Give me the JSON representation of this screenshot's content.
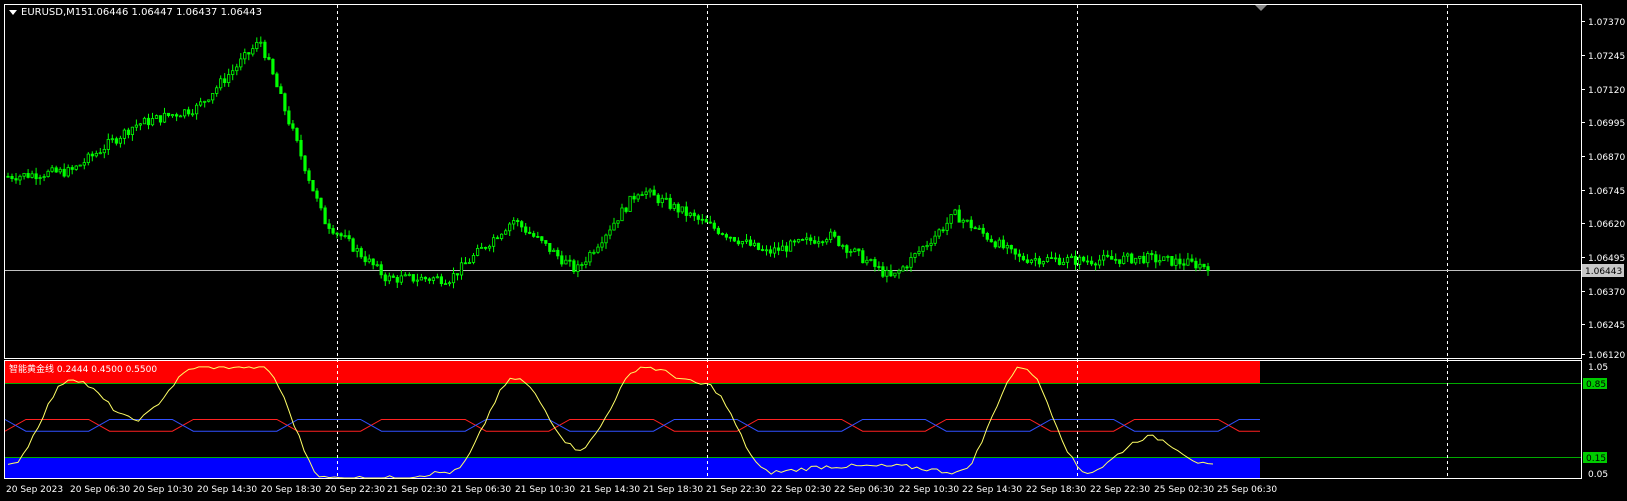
{
  "header": {
    "symbol_label": "EURUSD,M15",
    "ohlc": "1.06446 1.06447 1.06437 1.06443"
  },
  "price_axis": {
    "ticks": [
      "1.07370",
      "1.07245",
      "1.07120",
      "1.06995",
      "1.06870",
      "1.06745",
      "1.06620",
      "1.06495",
      "1.06370",
      "1.06245",
      "1.06120"
    ],
    "current_price": "1.06443"
  },
  "indicator": {
    "label": "智能黄金线 0.2444 0.4500 0.5500",
    "axis_ticks": {
      "top": "1.05",
      "upper_level": "0.85",
      "lower_level": "0.15",
      "bottom": "0.05"
    }
  },
  "time_axis": {
    "labels": [
      "20 Sep 2023",
      "20 Sep 06:30",
      "20 Sep 10:30",
      "20 Sep 14:30",
      "20 Sep 18:30",
      "20 Sep 22:30",
      "21 Sep 02:30",
      "21 Sep 06:30",
      "21 Sep 10:30",
      "21 Sep 14:30",
      "21 Sep 18:30",
      "21 Sep 22:30",
      "22 Sep 02:30",
      "22 Sep 06:30",
      "22 Sep 10:30",
      "22 Sep 14:30",
      "22 Sep 18:30",
      "22 Sep 22:30",
      "25 Sep 02:30",
      "25 Sep 06:30"
    ]
  },
  "colors": {
    "background": "#000000",
    "candles": "#00ff00",
    "grid": "#ffffff",
    "axis_text": "#ffffff",
    "current_price_line": "#c0c0c0",
    "zone_upper": "#ff0000",
    "zone_lower": "#0000ff",
    "oscillator_line": "#ffff66",
    "red_line": "#ff2020",
    "blue_line": "#3050ff",
    "level_box": "#00cc00"
  },
  "chart_data": {
    "type": "candlestick",
    "symbol": "EURUSD",
    "timeframe": "M15",
    "ylim": [
      1.0612,
      1.0742
    ],
    "close_path": [
      {
        "time": "20 Sep 2023",
        "value": 1.068
      },
      {
        "time": "20 Sep 06:30",
        "value": 1.0682
      },
      {
        "time": "20 Sep 10:30",
        "value": 1.07
      },
      {
        "time": "20 Sep 14:30",
        "value": 1.0707
      },
      {
        "time": "20 Sep 18:30",
        "value": 1.0733
      },
      {
        "time": "20 Sep 22:30",
        "value": 1.0663
      },
      {
        "time": "21 Sep 02:30",
        "value": 1.064
      },
      {
        "time": "21 Sep 06:30",
        "value": 1.064
      },
      {
        "time": "21 Sep 10:30",
        "value": 1.0663
      },
      {
        "time": "21 Sep 14:30",
        "value": 1.0643
      },
      {
        "time": "21 Sep 18:30",
        "value": 1.0675
      },
      {
        "time": "21 Sep 22:30",
        "value": 1.0662
      },
      {
        "time": "22 Sep 02:30",
        "value": 1.065
      },
      {
        "time": "22 Sep 06:30",
        "value": 1.0657
      },
      {
        "time": "22 Sep 10:30",
        "value": 1.064
      },
      {
        "time": "22 Sep 14:30",
        "value": 1.0665
      },
      {
        "time": "22 Sep 18:30",
        "value": 1.0648
      },
      {
        "time": "22 Sep 22:30",
        "value": 1.0647
      },
      {
        "time": "25 Sep 02:30",
        "value": 1.0648
      },
      {
        "time": "25 Sep 06:30",
        "value": 1.0645
      }
    ],
    "indicator": {
      "name": "智能黄金线",
      "values": [
        0.2444,
        0.45,
        0.55
      ],
      "ylim": [
        0.05,
        1.05
      ],
      "levels": [
        0.85,
        0.15
      ],
      "oscillator_path": [
        0.15,
        0.9,
        0.55,
        1.0,
        1.0,
        0.05,
        0.05,
        0.1,
        0.9,
        0.3,
        1.0,
        0.85,
        0.1,
        0.15,
        0.15,
        0.1,
        1.0,
        0.1,
        0.4,
        0.15
      ]
    }
  }
}
